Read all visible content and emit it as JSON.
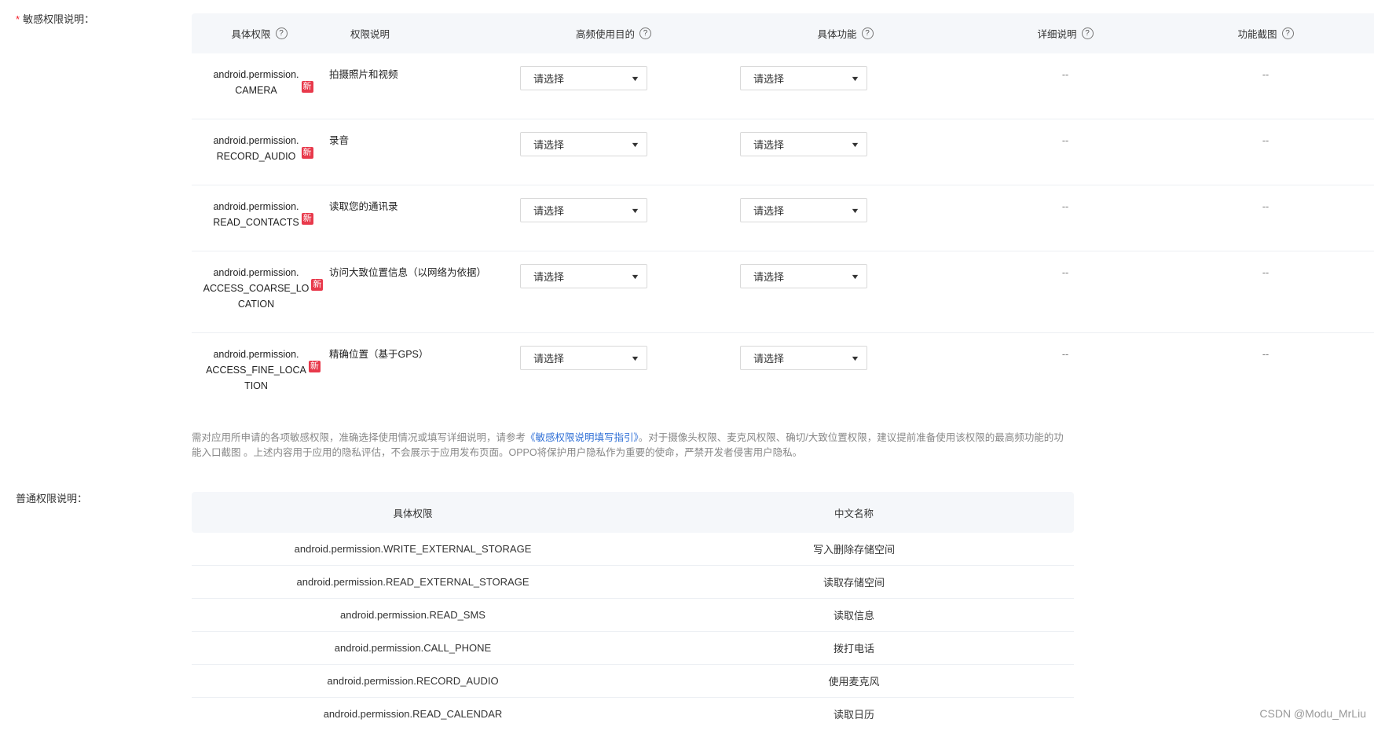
{
  "sensitive": {
    "label": "敏感权限说明：",
    "required_mark": "*",
    "headers": {
      "perm": "具体权限",
      "desc": "权限说明",
      "purpose": "高频使用目的",
      "function": "具体功能",
      "detail": "详细说明",
      "screenshot": "功能截图"
    },
    "new_badge": "新",
    "rows": [
      {
        "perm_lines": [
          "android.permission.",
          "CAMERA"
        ],
        "desc": "拍摄照片和视频",
        "purpose": "请选择",
        "function": "请选择",
        "detail": "--",
        "screenshot": "--"
      },
      {
        "perm_lines": [
          "android.permission.",
          "RECORD_AUDIO"
        ],
        "desc": "录音",
        "purpose": "请选择",
        "function": "请选择",
        "detail": "--",
        "screenshot": "--"
      },
      {
        "perm_lines": [
          "android.permission.",
          "READ_CONTACTS"
        ],
        "desc": "读取您的通讯录",
        "purpose": "请选择",
        "function": "请选择",
        "detail": "--",
        "screenshot": "--"
      },
      {
        "perm_lines": [
          "android.permission.",
          "ACCESS_COARSE_LO",
          "CATION"
        ],
        "desc": "访问大致位置信息（以网络为依据）",
        "purpose": "请选择",
        "function": "请选择",
        "detail": "--",
        "screenshot": "--"
      },
      {
        "perm_lines": [
          "android.permission.",
          "ACCESS_FINE_LOCA",
          "TION"
        ],
        "desc": "精确位置（基于GPS）",
        "purpose": "请选择",
        "function": "请选择",
        "detail": "--",
        "screenshot": "--"
      }
    ],
    "note_before": "需对应用所申请的各项敏感权限，准确选择使用情况或填写详细说明，请参考",
    "note_link": "《敏感权限说明填写指引》",
    "note_after": "。对于摄像头权限、麦克风权限、确切/大致位置权限，建议提前准备使用该权限的最高频功能的功能入口截图 。上述内容用于应用的隐私评估，不会展示于应用发布页面。OPPO将保护用户隐私作为重要的使命，严禁开发者侵害用户隐私。"
  },
  "normal": {
    "label": "普通权限说明：",
    "headers": {
      "perm": "具体权限",
      "name": "中文名称"
    },
    "rows": [
      {
        "perm": "android.permission.WRITE_EXTERNAL_STORAGE",
        "name": "写入删除存储空间"
      },
      {
        "perm": "android.permission.READ_EXTERNAL_STORAGE",
        "name": "读取存储空间"
      },
      {
        "perm": "android.permission.READ_SMS",
        "name": "读取信息"
      },
      {
        "perm": "android.permission.CALL_PHONE",
        "name": "拨打电话"
      },
      {
        "perm": "android.permission.RECORD_AUDIO",
        "name": "使用麦克风"
      },
      {
        "perm": "android.permission.READ_CALENDAR",
        "name": "读取日历"
      }
    ]
  },
  "watermark": "CSDN @Modu_MrLiu"
}
